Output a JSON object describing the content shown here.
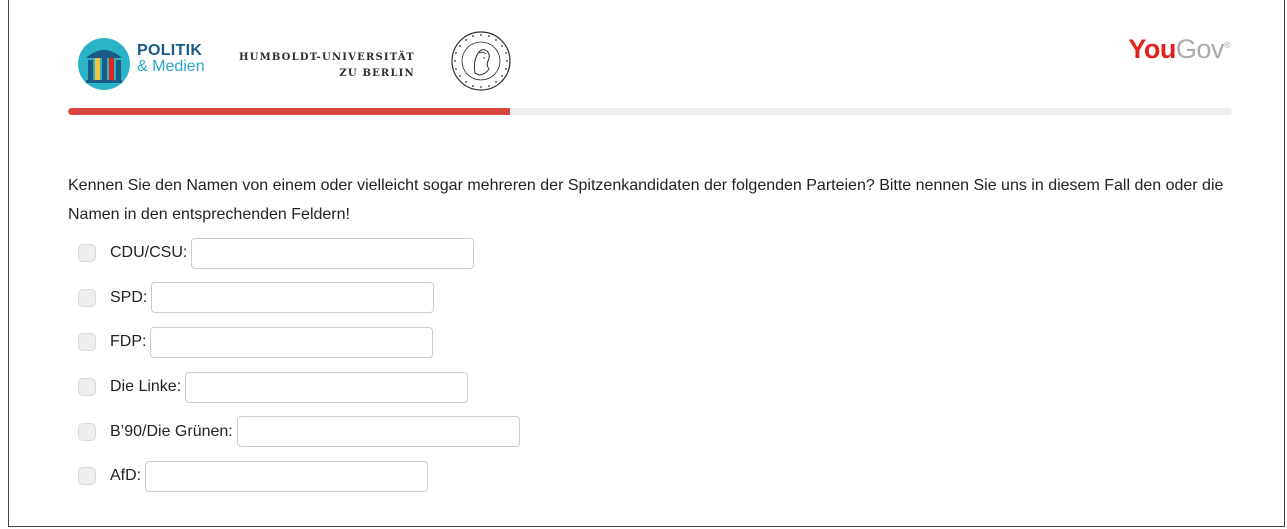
{
  "header": {
    "politik_logo": {
      "title": "POLITIK",
      "subtitle": "& Medien"
    },
    "humboldt_logo": {
      "line1": "HUMBOLDT-UNIVERSITÄT",
      "line2": "ZU BERLIN"
    },
    "yougov_logo": {
      "you": "You",
      "gov": "Gov",
      "mark": "®"
    },
    "colors": {
      "politik_dark": "#1a5b86",
      "politik_light": "#2aa8c7",
      "yougov_red": "#e2231a",
      "yougov_grey": "#aaaaaa"
    }
  },
  "progress": {
    "percent": 38,
    "fill_color": "#d64540",
    "track_color": "#eeeeee"
  },
  "question": {
    "text": "Kennen Sie den Namen von einem oder vielleicht sogar mehreren der Spitzenkandidaten der folgenden Parteien? Bitte nennen Sie uns in diesem Fall den oder die Namen in den entsprechenden Feldern!"
  },
  "options": [
    {
      "label": "CDU/CSU:",
      "value": "",
      "checked": false
    },
    {
      "label": "SPD:",
      "value": "",
      "checked": false
    },
    {
      "label": "FDP:",
      "value": "",
      "checked": false
    },
    {
      "label": "Die Linke:",
      "value": "",
      "checked": false
    },
    {
      "label": "B’90/Die Grünen:",
      "value": "",
      "checked": false
    },
    {
      "label": "AfD:",
      "value": "",
      "checked": false
    }
  ]
}
